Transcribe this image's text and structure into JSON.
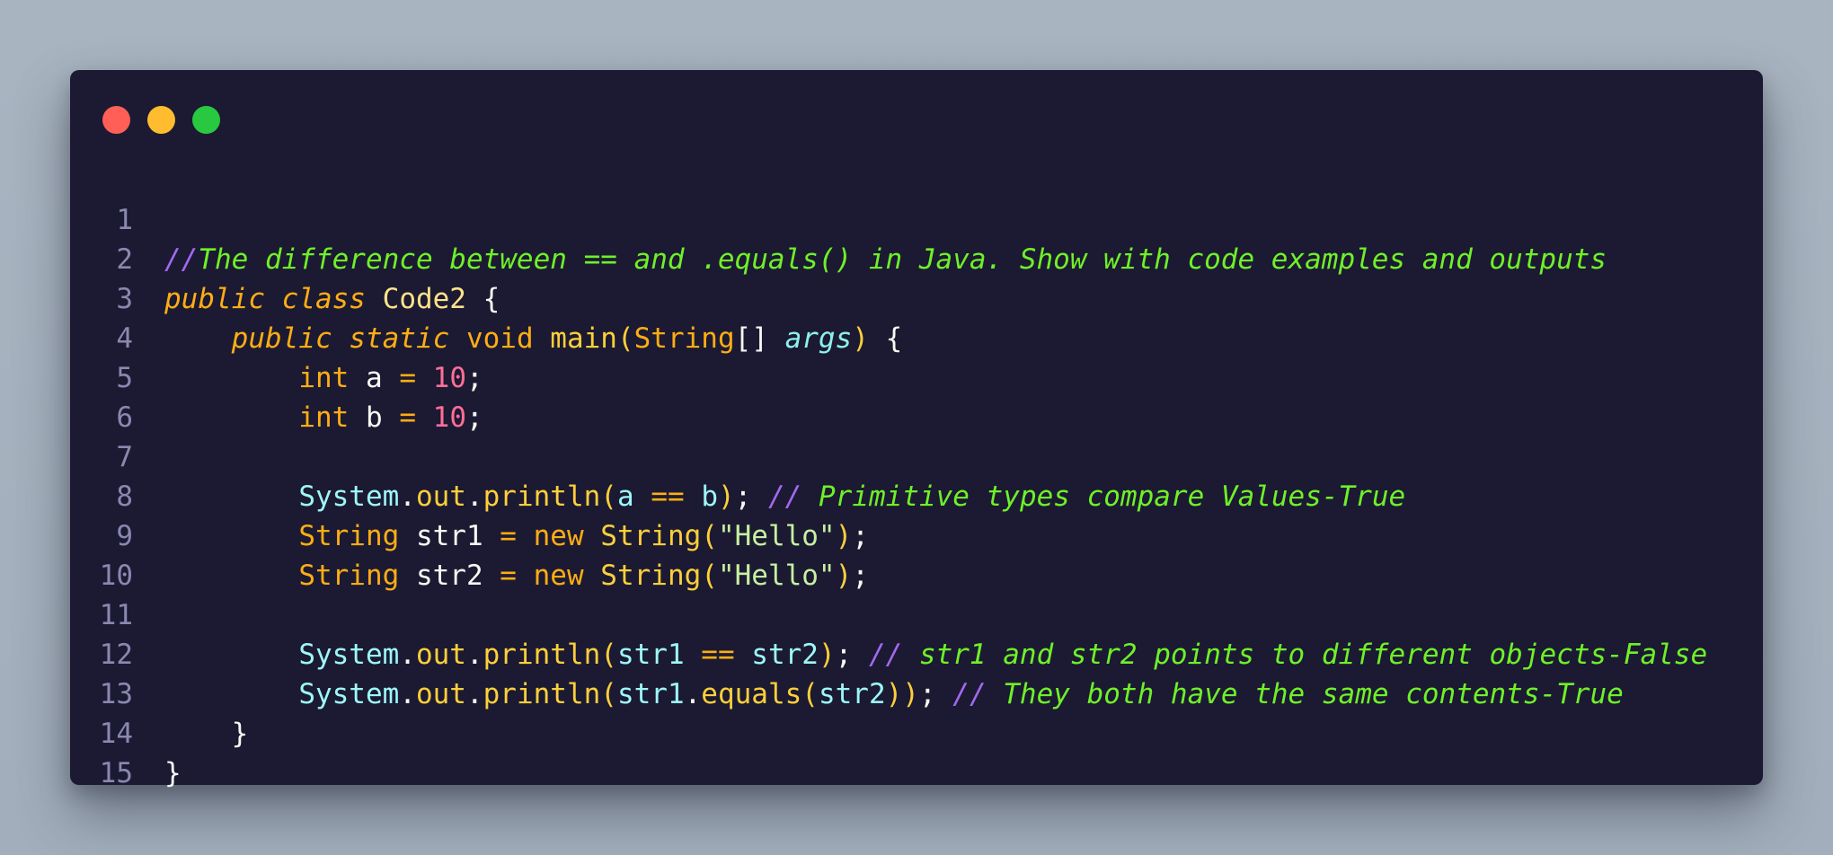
{
  "window": {
    "buttons": [
      "close",
      "minimize",
      "maximize"
    ]
  },
  "colors": {
    "background": "#a8b4c0",
    "editor_bg": "#1b1a32",
    "comment": "#6ff028",
    "keyword": "#ffad14",
    "number": "#ff6e99",
    "identifier": "#9ef6f8"
  },
  "lines": {
    "n1": "1",
    "n2": "2",
    "n3": "3",
    "n4": "4",
    "n5": "5",
    "n6": "6",
    "n7": "7",
    "n8": "8",
    "n9": "9",
    "n10": "10",
    "n11": "11",
    "n12": "12",
    "n13": "13",
    "n14": "14",
    "n15": "15"
  },
  "code": {
    "l1": {
      "slash": "//",
      "comment": "The difference between == and .equals() in Java. Show with code examples and outputs"
    },
    "l2": {
      "public": "public",
      "class": "class",
      "name": "Code2",
      "brace": " {"
    },
    "l3": {
      "indent": "    ",
      "public": "public",
      "static": "static",
      "void": "void",
      "main": "main",
      "open": "(",
      "type": "String",
      "arr": "[] ",
      "args": "args",
      "close": ")",
      "brace": " {"
    },
    "l4": {
      "indent": "        ",
      "type": "int",
      "var": " a ",
      "eq": "=",
      "sp": " ",
      "num": "10",
      "semi": ";"
    },
    "l5": {
      "indent": "        ",
      "type": "int",
      "var": " b ",
      "eq": "=",
      "sp": " ",
      "num": "10",
      "semi": ";"
    },
    "l7": {
      "indent": "        ",
      "system": "System",
      "dot1": ".",
      "out": "out",
      "dot2": ".",
      "println": "println",
      "open": "(",
      "a": "a",
      "sp1": " ",
      "op": "==",
      "sp2": " ",
      "b": "b",
      "close": ")",
      "semi": "; ",
      "slash": "//",
      "comment": " Primitive types compare Values-True"
    },
    "l8": {
      "indent": "        ",
      "type": "String",
      "var": " str1 ",
      "eq": "=",
      "sp": " ",
      "new": "new",
      "sp2": " ",
      "ctor": "String",
      "open": "(",
      "str": "\"Hello\"",
      "close": ")",
      "semi": ";"
    },
    "l9": {
      "indent": "        ",
      "type": "String",
      "var": " str2 ",
      "eq": "=",
      "sp": " ",
      "new": "new",
      "sp2": " ",
      "ctor": "String",
      "open": "(",
      "str": "\"Hello\"",
      "close": ")",
      "semi": ";"
    },
    "l11": {
      "indent": "        ",
      "system": "System",
      "dot1": ".",
      "out": "out",
      "dot2": ".",
      "println": "println",
      "open": "(",
      "a": "str1",
      "sp1": " ",
      "op": "==",
      "sp2": " ",
      "b": "str2",
      "close": ")",
      "semi": "; ",
      "slash": "//",
      "comment": " str1 and str2 points to different objects-False"
    },
    "l12": {
      "indent": "        ",
      "system": "System",
      "dot1": ".",
      "out": "out",
      "dot2": ".",
      "println": "println",
      "open": "(",
      "a": "str1",
      "dot3": ".",
      "equals": "equals",
      "open2": "(",
      "b": "str2",
      "close2": ")",
      "close": ")",
      "semi": "; ",
      "slash": "//",
      "comment": " They both have the same contents-True"
    },
    "l13": {
      "indent": "    ",
      "brace": "}"
    },
    "l14": {
      "brace": "}"
    }
  }
}
